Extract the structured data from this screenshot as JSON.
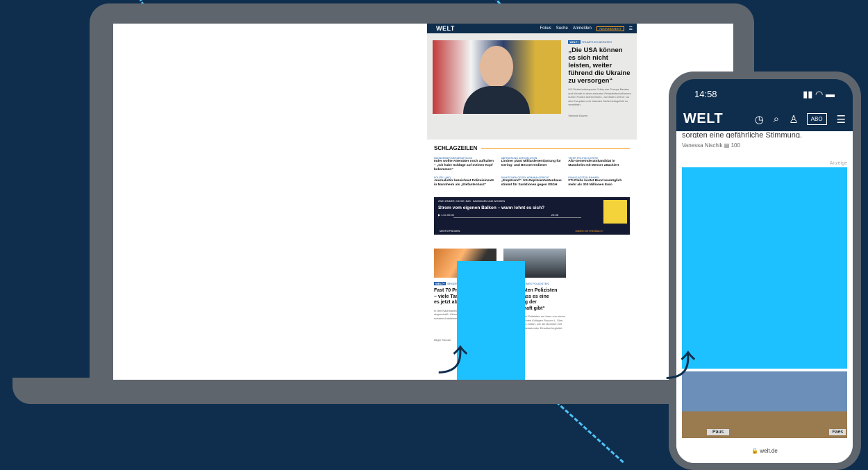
{
  "laptop": {
    "header": {
      "logo": "WELT",
      "nav": [
        "Fokus",
        "Suche",
        "Anmelden",
        "ABONNEMENT"
      ]
    },
    "hero": {
      "kicker": "TRUMPS EX-BERATER",
      "headline": "„Die USA können es sich nicht leisten, weiter führend die Ukraine zu versorgen“",
      "teaser": "US-Sicherheitsexperte Colby war Trumps Berater und könnte in einer erneuten Präsidentschaft einen hohen Posten übernehmen. Joe Biden wirft er vor den Europäern ein falsches Sicherheitsgefühl zu vermitteln.",
      "author": "Stefanie Bolzen"
    },
    "schlagzeilen": {
      "title": "SCHLAGZEILEN",
      "items": [
        {
          "kicker": "MANNHEIMER MESSERATTACKE",
          "head": "Inder wollte Attentäter noch aufhalten – „Ich habe Schläge auf meinen Kopf bekommen“"
        },
        {
          "kicker": "ABFEDERUNG DER INFLATION",
          "head": "Lindner plant Milliardenentlastung für Gering- und Besserverdiener"
        },
        {
          "kicker": "TÄTER POLITISCH KRITIK",
          "head": "AfD-Gemeinderatskandidat in Mannheim mit Messer attackiert"
        },
        {
          "kicker": "POLIZEI LAND",
          "head": "Journalistin bezeichnet Polizeieinsatz in Mannheim als „Elefantenhaut“"
        },
        {
          "kicker": "SANKTIONEN GEGEN KRIMINALGERICHT",
          "head": "„Empörend“: US-Repräsentantenhaus stimmt für Sanktionen gegen IStGH"
        },
        {
          "kicker": "FINANZ-KOSTEN-RAHMEN",
          "head": "FTI-Pleite kostet Bund womöglich mehr als 300 Millionen Euro"
        }
      ]
    },
    "podcast": {
      "kicker": "ZWEI ZIMMER, KÜCHE, BAD · IMMOBILIEN UND WOHNEN",
      "title": "Strom vom eigenen Balkon – wann lohnt es sich?",
      "speed": "1.0x",
      "time_start": "00:00",
      "time_end": "23:36",
      "more": "MEHR EPISODEN",
      "feedback": "HABEN SIE FEEDBACK?"
    },
    "cards": [
      {
        "kicker": "BENZINE AUS KRAFT-PER-PUMPE",
        "headline": "Fast 70 Prozent tanken E5 – viele Tankstellen wollen es jetzt abschaffen",
        "teaser": "In den Nachbarländern wurde es teilweise schon abgeschafft. Hierzulande können immer noch die meisten Autofahrer Superbenzin E5 tanken.",
        "author": "Birger Nicolai"
      },
      {
        "kicker": "TOD EINES POLIZISTEN",
        "headline": "„Die meisten Polizisten sehen, dass es eine Verrohung der Gesellschaft gibt“",
        "teaser": "Bundesweit trauern Polizisten um ihren von einem Afghanen erstochenen Kollegen Rouven L. Eine Polizeiseelsorgerin erklärt, wie die Beamten mit der Verarbeitung belastender Einsätze begleitet.",
        "author": "Vanessa Nischik"
      }
    ]
  },
  "phone": {
    "time": "14:58",
    "logo": "WELT",
    "abo": "ABO",
    "text": "sorgten eine gefährliche Stimmung.",
    "author": "Vanessa Nischik",
    "comments": "100",
    "ad_label": "Anzeige",
    "photo_labels": [
      "Paus",
      "Faes"
    ],
    "url": "welt.de"
  },
  "colors": {
    "background": "#0f2e4d",
    "device": "#5f656d",
    "ad": "#1ec1ff",
    "accent": "#f4a024"
  }
}
